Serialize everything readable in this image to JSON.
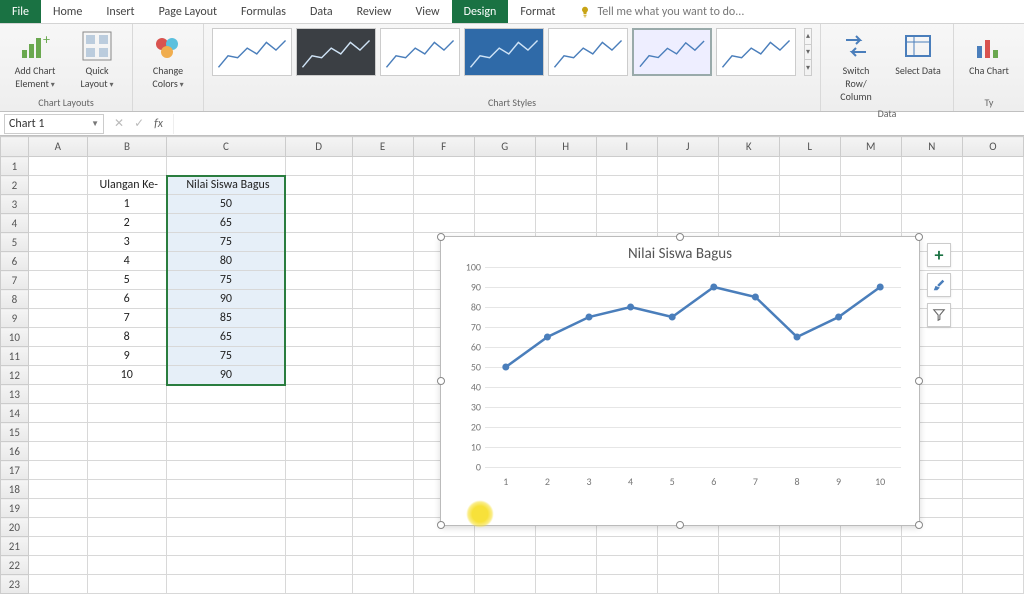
{
  "tabs": {
    "file": "File",
    "items": [
      "Home",
      "Insert",
      "Page Layout",
      "Formulas",
      "Data",
      "Review",
      "View",
      "Design",
      "Format"
    ],
    "active": "Design",
    "tellme": "Tell me what you want to do..."
  },
  "ribbon": {
    "chart_layouts": {
      "label": "Chart Layouts",
      "add_element": "Add Chart Element",
      "quick_layout": "Quick Layout"
    },
    "change_colors": {
      "label": "Change Colors"
    },
    "chart_styles": {
      "label": "Chart Styles"
    },
    "data_group": {
      "label": "Data",
      "switch": "Switch Row/ Column",
      "select": "Select Data"
    },
    "type_group": {
      "label": "Ty",
      "change_chart": "Cha Chart"
    }
  },
  "name_box": "Chart 1",
  "formula_bar": {
    "fx_label": "fx",
    "value": ""
  },
  "columns": [
    "A",
    "B",
    "C",
    "D",
    "E",
    "F",
    "G",
    "H",
    "I",
    "J",
    "K",
    "L",
    "M",
    "N",
    "O"
  ],
  "row_count": 23,
  "table": {
    "header_b": "Ulangan Ke-",
    "header_c": "Nilai Siswa Bagus",
    "rows": [
      {
        "n": "1",
        "v": "50"
      },
      {
        "n": "2",
        "v": "65"
      },
      {
        "n": "3",
        "v": "75"
      },
      {
        "n": "4",
        "v": "80"
      },
      {
        "n": "5",
        "v": "75"
      },
      {
        "n": "6",
        "v": "90"
      },
      {
        "n": "7",
        "v": "85"
      },
      {
        "n": "8",
        "v": "65"
      },
      {
        "n": "9",
        "v": "75"
      },
      {
        "n": "10",
        "v": "90"
      }
    ]
  },
  "chart_data": {
    "type": "line",
    "title": "Nilai Siswa Bagus",
    "categories": [
      "1",
      "2",
      "3",
      "4",
      "5",
      "6",
      "7",
      "8",
      "9",
      "10"
    ],
    "values": [
      50,
      65,
      75,
      80,
      75,
      90,
      85,
      65,
      75,
      90
    ],
    "ylim": [
      0,
      100
    ],
    "ystep": 10,
    "xlabel": "",
    "ylabel": "",
    "series_color": "#4a7ebb"
  }
}
